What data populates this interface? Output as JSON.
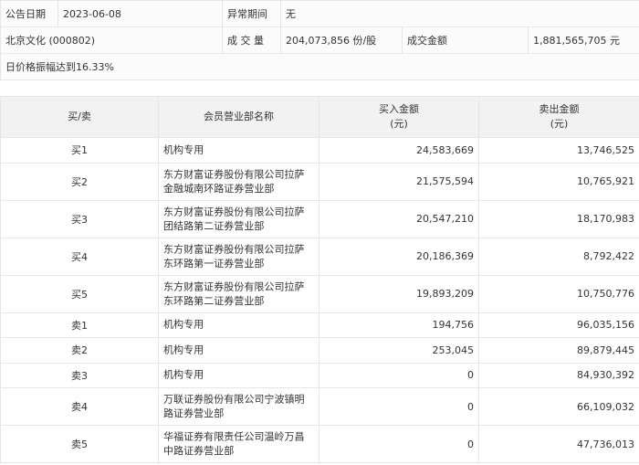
{
  "info": {
    "date_label": "公告日期",
    "date": "2023-06-08",
    "period_label": "异常期间",
    "period": "无",
    "stock": "北京文化 (000802)",
    "volume_label": "成 交 量",
    "volume": "204,073,856 份/股",
    "amount_label": "成交金额",
    "amount": "1,881,565,705 元",
    "reason": "日价格振幅达到16.33%"
  },
  "table": {
    "headers": {
      "side": "买/卖",
      "name": "会员营业部名称",
      "buy": "买入金额",
      "buy_unit": "(元)",
      "sell": "卖出金额",
      "sell_unit": "(元)"
    },
    "rows": [
      {
        "side": "买1",
        "name": "机构专用",
        "buy": "24,583,669",
        "sell": "13,746,525"
      },
      {
        "side": "买2",
        "name": "东方财富证券股份有限公司拉萨金融城南环路证券营业部",
        "buy": "21,575,594",
        "sell": "10,765,921"
      },
      {
        "side": "买3",
        "name": "东方财富证券股份有限公司拉萨团结路第二证券营业部",
        "buy": "20,547,210",
        "sell": "18,170,983"
      },
      {
        "side": "买4",
        "name": "东方财富证券股份有限公司拉萨东环路第一证券营业部",
        "buy": "20,186,369",
        "sell": "8,792,422"
      },
      {
        "side": "买5",
        "name": "东方财富证券股份有限公司拉萨东环路第二证券营业部",
        "buy": "19,893,209",
        "sell": "10,750,776"
      },
      {
        "side": "卖1",
        "name": "机构专用",
        "buy": "194,756",
        "sell": "96,035,156"
      },
      {
        "side": "卖2",
        "name": "机构专用",
        "buy": "253,045",
        "sell": "89,879,445"
      },
      {
        "side": "卖3",
        "name": "机构专用",
        "buy": "0",
        "sell": "84,930,392"
      },
      {
        "side": "卖4",
        "name": "万联证券股份有限公司宁波镇明路证券营业部",
        "buy": "0",
        "sell": "66,109,032"
      },
      {
        "side": "卖5",
        "name": "华福证券有限责任公司温岭万昌中路证券营业部",
        "buy": "0",
        "sell": "47,736,013"
      }
    ]
  }
}
